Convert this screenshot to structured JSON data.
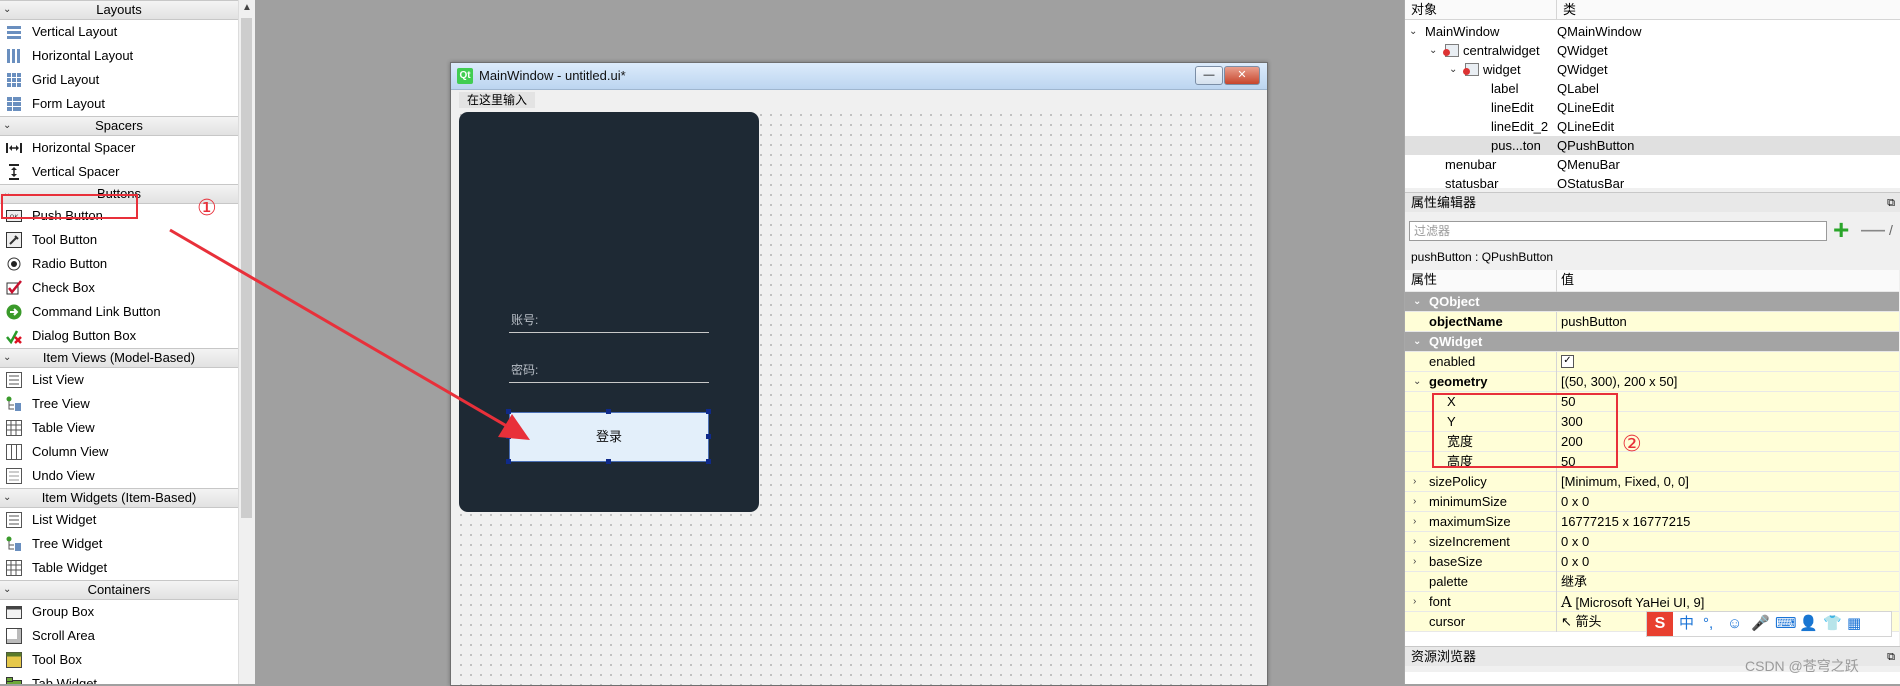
{
  "widget_box": {
    "categories": {
      "layouts": "Layouts",
      "spacers": "Spacers",
      "buttons": "Buttons",
      "item_views": "Item Views (Model-Based)",
      "item_widgets": "Item Widgets (Item-Based)",
      "containers": "Containers"
    },
    "layouts": [
      "Vertical Layout",
      "Horizontal Layout",
      "Grid Layout",
      "Form Layout"
    ],
    "spacers": [
      "Horizontal Spacer",
      "Vertical Spacer"
    ],
    "buttons": [
      "Push Button",
      "Tool Button",
      "Radio Button",
      "Check Box",
      "Command Link Button",
      "Dialog Button Box"
    ],
    "item_views": [
      "List View",
      "Tree View",
      "Table View",
      "Column View",
      "Undo View"
    ],
    "item_widgets": [
      "List Widget",
      "Tree Widget",
      "Table Widget"
    ],
    "containers": [
      "Group Box",
      "Scroll Area",
      "Tool Box",
      "Tab Widget"
    ]
  },
  "annotations": {
    "step1": "①",
    "step2": "②"
  },
  "main_window": {
    "icon": "Qt",
    "title": "MainWindow - untitled.ui*",
    "menu_placeholder": "在这里输入",
    "minimize": "—",
    "close": "✕"
  },
  "login_form": {
    "account_label": "账号:",
    "password_label": "密码:",
    "login_button": "登录"
  },
  "object_inspector": {
    "col_object": "对象",
    "col_class": "类",
    "rows": [
      {
        "name": "MainWindow",
        "class": "QMainWindow"
      },
      {
        "name": "centralwidget",
        "class": "QWidget"
      },
      {
        "name": "widget",
        "class": "QWidget"
      },
      {
        "name": "label",
        "class": "QLabel"
      },
      {
        "name": "lineEdit",
        "class": "QLineEdit"
      },
      {
        "name": "lineEdit_2",
        "class": "QLineEdit"
      },
      {
        "name": "pus...ton",
        "class": "QPushButton"
      },
      {
        "name": "menubar",
        "class": "QMenuBar"
      },
      {
        "name": "statusbar",
        "class": "QStatusBar"
      }
    ]
  },
  "property_editor": {
    "title": "属性编辑器",
    "filter_placeholder": "过滤器",
    "object_class": "pushButton : QPushButton",
    "col_property": "属性",
    "col_value": "值",
    "sections": {
      "qobject": "QObject",
      "qwidget": "QWidget"
    },
    "rows": {
      "objectName": {
        "name": "objectName",
        "value": "pushButton"
      },
      "enabled": {
        "name": "enabled",
        "value": "✓"
      },
      "geometry": {
        "name": "geometry",
        "value": "[(50, 300), 200 x 50]"
      },
      "x": {
        "name": "X",
        "value": "50"
      },
      "y": {
        "name": "Y",
        "value": "300"
      },
      "width": {
        "name": "宽度",
        "value": "200"
      },
      "height": {
        "name": "高度",
        "value": "50"
      },
      "sizePolicy": {
        "name": "sizePolicy",
        "value": "[Minimum, Fixed, 0, 0]"
      },
      "minimumSize": {
        "name": "minimumSize",
        "value": "0 x 0"
      },
      "maximumSize": {
        "name": "maximumSize",
        "value": "16777215 x 16777215"
      },
      "sizeIncrement": {
        "name": "sizeIncrement",
        "value": "0 x 0"
      },
      "baseSize": {
        "name": "baseSize",
        "value": "0 x 0"
      },
      "palette": {
        "name": "palette",
        "value": "继承"
      },
      "font": {
        "name": "font",
        "value": "[Microsoft YaHei UI, 9]"
      },
      "cursor": {
        "name": "cursor",
        "value": "箭头"
      }
    }
  },
  "resource_browser": {
    "title": "资源浏览器"
  },
  "ime": {
    "logo": "S",
    "glyphs": [
      "中",
      "°,",
      "☺",
      "🎤",
      "⌨",
      "👤",
      "👕",
      "▦"
    ]
  },
  "watermark": "CSDN @苍穹之跃",
  "colors": {
    "highlight_red": "#e8303a",
    "login_panel_bg": "#1e2934",
    "button_bg": "#e3effa",
    "property_yellow": "#fffed7"
  }
}
